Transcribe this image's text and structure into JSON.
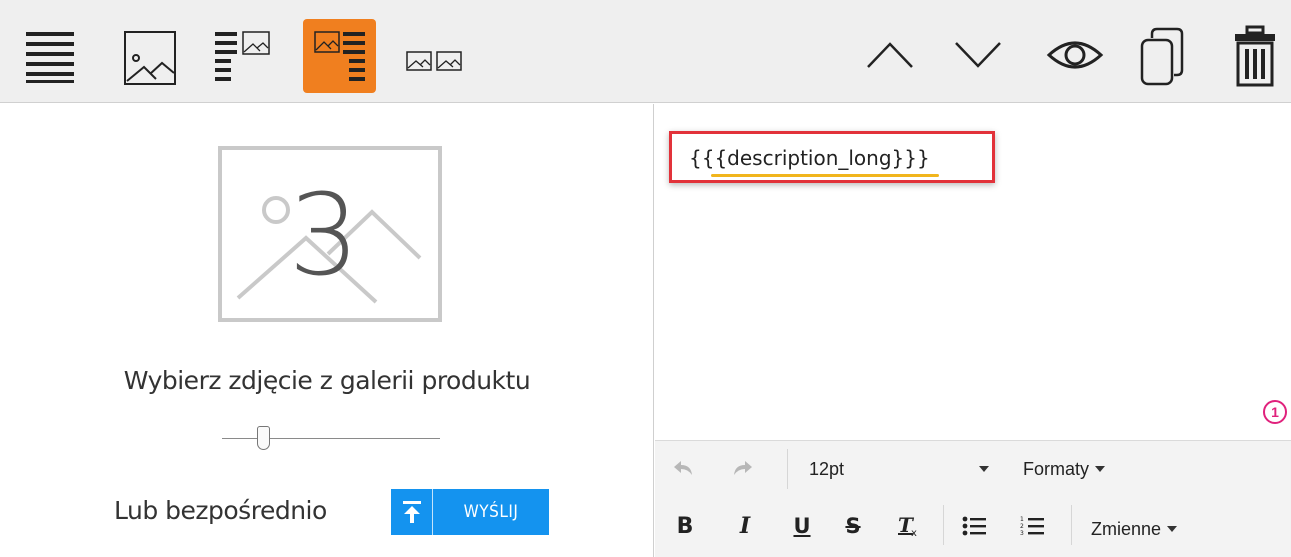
{
  "toolbar": {
    "left_tools": [
      {
        "name": "text-only-layout-icon",
        "active": false
      },
      {
        "name": "image-only-layout-icon",
        "active": false
      },
      {
        "name": "text-left-image-right-layout-icon",
        "active": false
      },
      {
        "name": "image-left-text-right-layout-icon",
        "active": true
      },
      {
        "name": "two-images-layout-icon",
        "active": false
      }
    ],
    "right_tools": [
      "chevron-up-icon",
      "chevron-down-icon",
      "eye-icon",
      "duplicate-icon",
      "trash-icon"
    ],
    "active_color": "#f07f1f"
  },
  "left_panel": {
    "placeholder_number": "3",
    "pick_label": "Wybierz zdjęcie z galerii produktu",
    "slider_value": 0.17,
    "or_label": "Lub bezpośrednio",
    "send_label": "WYŚLIJ",
    "send_color": "#1493ef"
  },
  "editor": {
    "content": "{{{description_long}}}",
    "badge": "1",
    "highlight_color": "#e2323a",
    "font_size": "12pt",
    "formats_label": "Formaty",
    "variables_label": "Zmienne",
    "buttons": [
      "undo-icon",
      "redo-icon",
      "bold-button",
      "italic-button",
      "underline-button",
      "strikethrough-button",
      "clear-format-button",
      "bullet-list-button",
      "numbered-list-button"
    ]
  }
}
